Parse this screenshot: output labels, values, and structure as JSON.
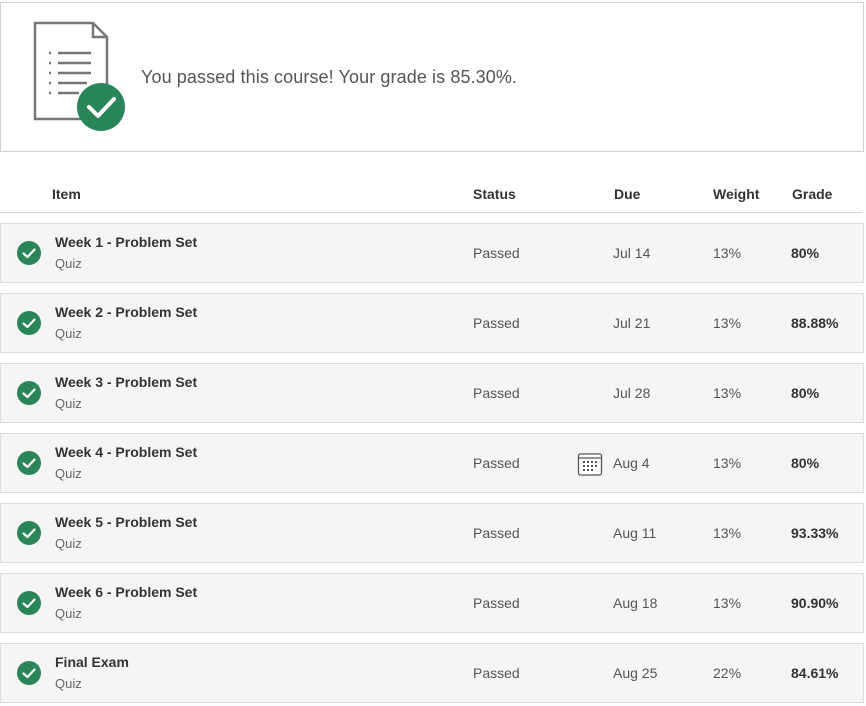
{
  "banner": {
    "message": "You passed this course! Your grade is 85.30%.",
    "icon": "document-check-icon"
  },
  "table": {
    "headers": {
      "item": "Item",
      "status": "Status",
      "due": "Due",
      "weight": "Weight",
      "grade": "Grade"
    },
    "rows": [
      {
        "title": "Week 1 - Problem Set",
        "type": "Quiz",
        "status": "Passed",
        "due": "Jul 14",
        "weight": "13%",
        "grade": "80%",
        "calendar_icon": false
      },
      {
        "title": "Week 2 - Problem Set",
        "type": "Quiz",
        "status": "Passed",
        "due": "Jul 21",
        "weight": "13%",
        "grade": "88.88%",
        "calendar_icon": false
      },
      {
        "title": "Week 3 - Problem Set",
        "type": "Quiz",
        "status": "Passed",
        "due": "Jul 28",
        "weight": "13%",
        "grade": "80%",
        "calendar_icon": false
      },
      {
        "title": "Week 4 - Problem Set",
        "type": "Quiz",
        "status": "Passed",
        "due": "Aug 4",
        "weight": "13%",
        "grade": "80%",
        "calendar_icon": true
      },
      {
        "title": "Week 5 - Problem Set",
        "type": "Quiz",
        "status": "Passed",
        "due": "Aug 11",
        "weight": "13%",
        "grade": "93.33%",
        "calendar_icon": false
      },
      {
        "title": "Week 6 - Problem Set",
        "type": "Quiz",
        "status": "Passed",
        "due": "Aug 18",
        "weight": "13%",
        "grade": "90.90%",
        "calendar_icon": false
      },
      {
        "title": "Final Exam",
        "type": "Quiz",
        "status": "Passed",
        "due": "Aug 25",
        "weight": "22%",
        "grade": "84.61%",
        "calendar_icon": false
      }
    ]
  },
  "colors": {
    "accent_green": "#2a8558",
    "row_bg": "#f5f5f5",
    "border": "#dcdcdc"
  }
}
